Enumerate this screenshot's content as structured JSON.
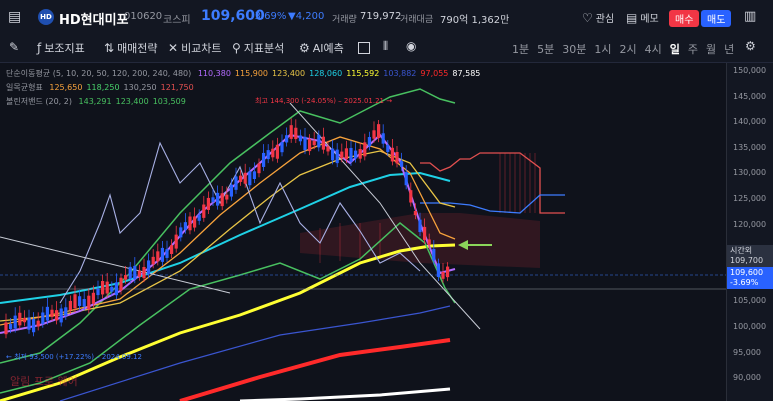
{
  "header": {
    "stock_name": "HD현대미포",
    "code": "010620",
    "market": "코스피",
    "price": "109,600",
    "change_pct": "-3.69%",
    "change_amt": "▼4,200",
    "volume_label": "거래량",
    "volume": "719,972",
    "value_label": "거래대금",
    "value": "790억 1,362만",
    "watch_label": "관심",
    "memo_label": "메모",
    "buy_label": "매수",
    "sell_label": "매도"
  },
  "toolbar": {
    "indicator_label": "보조지표",
    "strategy_label": "매매전략",
    "compare_label": "비교차트",
    "analysis_label": "지표분석",
    "ai_label": "AI예측",
    "periods": [
      "1분",
      "5분",
      "30분",
      "1시",
      "2시",
      "4시",
      "일",
      "주",
      "월",
      "년"
    ],
    "active_period": "일"
  },
  "legend": {
    "sma_label": "단순이동평균",
    "sma_params": "(5, 10, 20, 50, 120, 200, 240, 480)",
    "sma_values": [
      {
        "v": "110,380",
        "color": "#b36bff"
      },
      {
        "v": "115,900",
        "color": "#f7a23c"
      },
      {
        "v": "123,400",
        "color": "#e8c547"
      },
      {
        "v": "128,060",
        "color": "#1fd1e6"
      },
      {
        "v": "115,592",
        "color": "#ffff33"
      },
      {
        "v": "103,882",
        "color": "#3a55d0"
      },
      {
        "v": "97,055",
        "color": "#ff2a2a"
      },
      {
        "v": "87,585",
        "color": "#ffffff"
      }
    ],
    "ichimoku_label": "일목균형표",
    "ichimoku_values": [
      {
        "v": "125,650",
        "color": "#f7a23c"
      },
      {
        "v": "118,250",
        "color": "#48d06a"
      },
      {
        "v": "130,250",
        "color": "#9598a1"
      },
      {
        "v": "121,750",
        "color": "#e25050"
      }
    ],
    "bb_label": "볼린저밴드",
    "bb_params": "(20, 2)",
    "bb_values": [
      {
        "v": "143,291",
        "color": "#48c060"
      },
      {
        "v": "123,400",
        "color": "#48c060"
      },
      {
        "v": "103,509",
        "color": "#48c060"
      }
    ]
  },
  "annotations": {
    "high": "최고 144,300 (-24.05%) – 2025.01.21 →",
    "low": "← 최저 93,500 (+17.22%) – 2024.09.12",
    "watermark": "알림 프로 웨어"
  },
  "axis": {
    "labels": [
      "150,000",
      "145,000",
      "140,000",
      "135,000",
      "130,000",
      "125,000",
      "120,000",
      "115,000",
      "110,000",
      "105,000",
      "100,000",
      "95,000",
      "90,000"
    ],
    "time_tag_label": "시간외",
    "time_tag_value": "109,700",
    "price_tag_value": "109,600",
    "price_tag_pct": "-3.69%"
  },
  "colors": {
    "up": "#f23645",
    "down": "#2962ff",
    "accent_blue": "#3d7cff"
  }
}
